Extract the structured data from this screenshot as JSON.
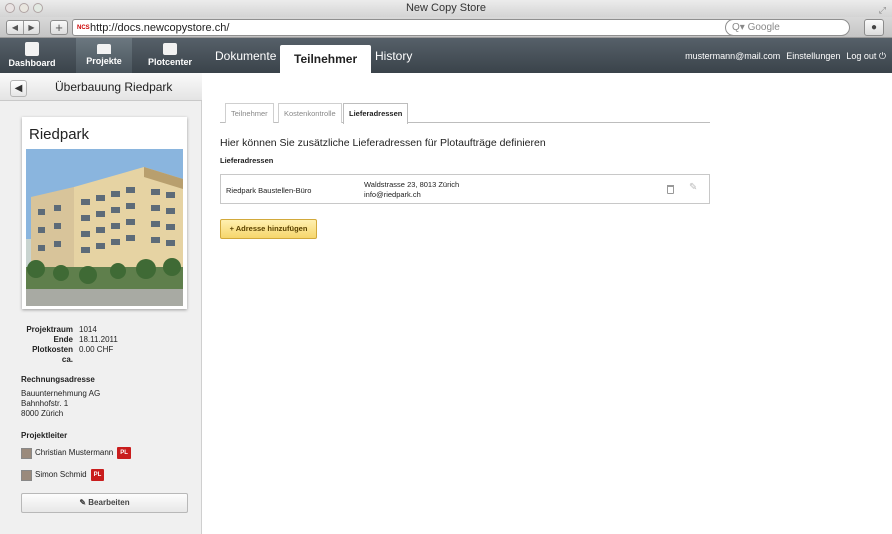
{
  "window": {
    "title": "New Copy Store"
  },
  "browser": {
    "back": "◀",
    "forward": "▶",
    "new_tab": "+",
    "favicon": "NCS",
    "url": "http://docs.newcopystore.ch/",
    "reload": "ↄ",
    "search_placeholder": "Q▾ Google"
  },
  "appnav": {
    "icons": [
      {
        "label": "Dashboard",
        "icon": "clipboard-icon"
      },
      {
        "label": "Projekte",
        "icon": "laptop-icon",
        "active": true
      },
      {
        "label": "Plotcenter",
        "icon": "printer-icon"
      }
    ],
    "tabs": [
      {
        "label": "Dokumente"
      },
      {
        "label": "Teilnehmer",
        "active": true
      },
      {
        "label": "History"
      }
    ],
    "user": "mustermann@mail.com",
    "settings": "Einstellungen",
    "logout": "Log out ⏻"
  },
  "sidebar": {
    "title": "Überbauung Riedpark",
    "card_title": "Riedpark",
    "info": [
      {
        "key": "Projektraum",
        "value": "1014"
      },
      {
        "key": "Ende",
        "value": "18.11.2011"
      },
      {
        "key": "Plotkosten ca.",
        "value": "0.00 CHF"
      }
    ],
    "billing_heading": "Rechnungsadresse",
    "billing_lines": [
      "Bauunternehmung AG",
      "Bahnhofstr. 1",
      "8000 Zürich"
    ],
    "leaders_heading": "Projektleiter",
    "leaders": [
      {
        "name": "Christian Mustermann",
        "badge": "PL"
      },
      {
        "name": "Simon Schmid",
        "badge": "PL"
      }
    ],
    "edit_button": "Bearbeiten"
  },
  "main": {
    "subtabs": [
      {
        "label": "Teilnehmer"
      },
      {
        "label": "Kostenkontrolle"
      },
      {
        "label": "Lieferadressen",
        "active": true
      }
    ],
    "heading": "Hier können Sie zusätzliche Lieferadressen für Plotaufträge definieren",
    "subheading": "Lieferadressen",
    "addresses": [
      {
        "name": "Riedpark Baustellen-Büro",
        "street": "Waldstrasse 23, 8013 Zürich",
        "email": "info@riedpark.ch"
      }
    ],
    "add_button": "+ Adresse hinzufügen"
  },
  "colors": {
    "nav_bg": "#3f4950",
    "badge": "#c91d1d",
    "add_button": "#f6d66c"
  }
}
